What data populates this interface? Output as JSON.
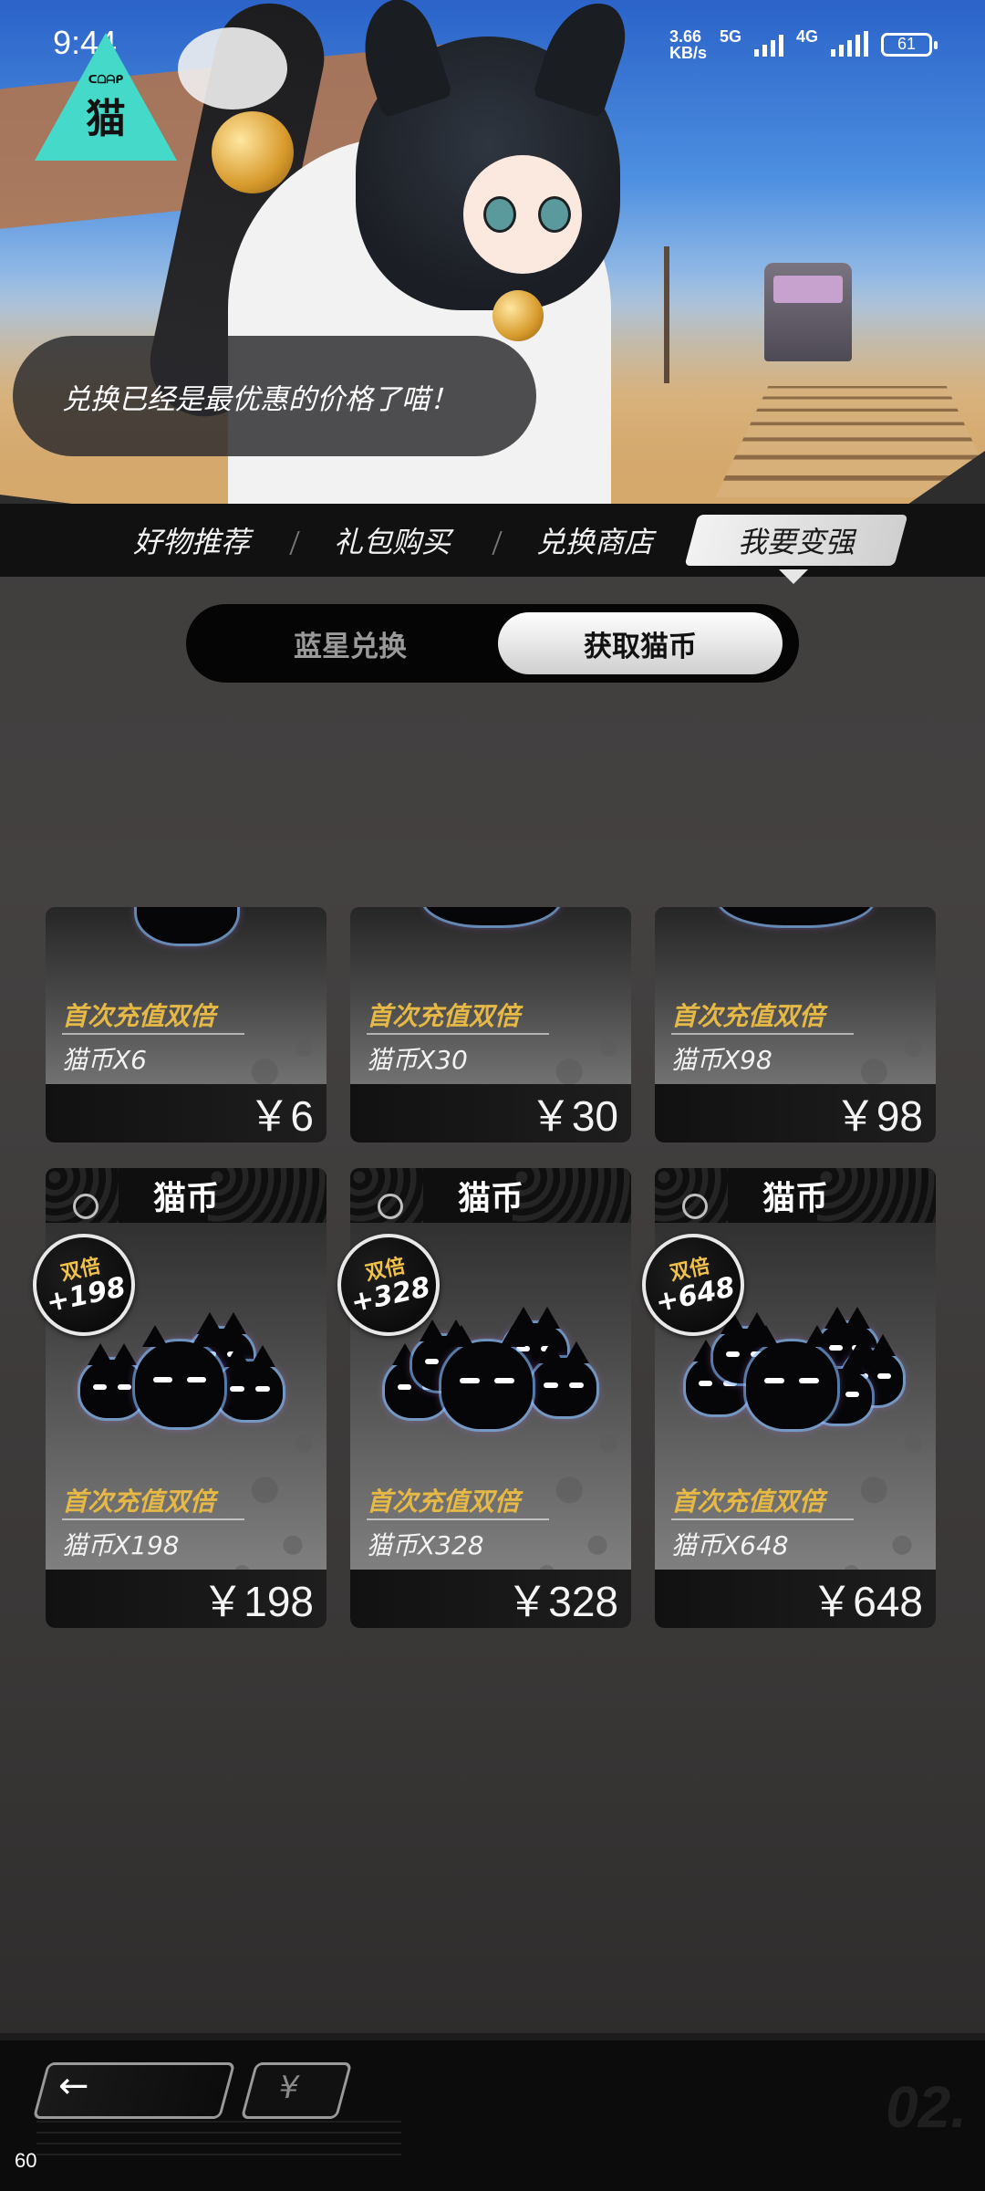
{
  "status_bar": {
    "time": "9:44",
    "net_speed_value": "3.66",
    "net_speed_unit": "KB/s",
    "net_type_1": "5G",
    "net_type_2": "4G",
    "battery": "61"
  },
  "logo": {
    "text": "猫",
    "sub": "ᑕᗝᗩᑭ"
  },
  "dialogue": {
    "text": "兑换已经是最优惠的价格了喵！"
  },
  "tabs": [
    {
      "label": "好物推荐"
    },
    {
      "label": "礼包购买"
    },
    {
      "label": "兑换商店"
    },
    {
      "label": "我要变强",
      "active": true
    }
  ],
  "segment": {
    "options": [
      "蓝星兑换",
      "获取猫币"
    ],
    "selected": "获取猫币"
  },
  "products_row1": [
    {
      "promo": "首次充值双倍",
      "amount": "猫币X6",
      "price": "￥6"
    },
    {
      "promo": "首次充值双倍",
      "amount": "猫币X30",
      "price": "￥30"
    },
    {
      "promo": "首次充值双倍",
      "amount": "猫币X98",
      "price": "￥98"
    }
  ],
  "products_row2": [
    {
      "title": "猫币",
      "badge_label": "双倍",
      "badge_value": "+198",
      "promo": "首次充值双倍",
      "amount": "猫币X198",
      "price": "￥198"
    },
    {
      "title": "猫币",
      "badge_label": "双倍",
      "badge_value": "+328",
      "promo": "首次充值双倍",
      "amount": "猫币X328",
      "price": "￥328"
    },
    {
      "title": "猫币",
      "badge_label": "双倍",
      "badge_value": "+648",
      "promo": "首次充值双倍",
      "amount": "猫币X648",
      "price": "￥648"
    }
  ],
  "bottom_nav": {
    "back_glyph": "←",
    "currency_glyph": "¥",
    "page_index": "02."
  },
  "overlay": {
    "fps": "60"
  },
  "colors": {
    "accent_gold": "#e6b946",
    "logo_teal": "#44d9c8",
    "active_tab": "#f2f2f2",
    "background": "#3f3c3c"
  }
}
